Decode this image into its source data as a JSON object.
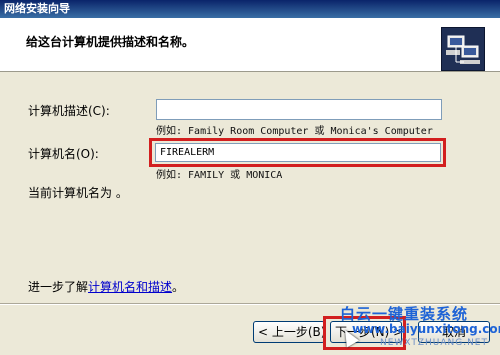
{
  "window": {
    "title": "网络安装向导"
  },
  "header": {
    "title": "给这台计算机提供描述和名称。",
    "icon": "network-computers-icon"
  },
  "form": {
    "description_label": "计算机描述(C):",
    "description_value": "",
    "description_example": "例如: Family Room Computer 或 Monica's Computer",
    "name_label": "计算机名(O):",
    "name_value": "FIREALERM",
    "name_example": "例如: FAMILY 或 MONICA",
    "current_name_text": "当前计算机名为 。"
  },
  "footer": {
    "learn_more_prefix": "进一步了解",
    "learn_more_link": "计算机名和描述",
    "learn_more_suffix": "。"
  },
  "buttons": {
    "back": "< 上一步(B)",
    "next": "下一步(N) >",
    "cancel": "取消"
  },
  "watermark": {
    "title": "白云一键重装系统",
    "url": "www.baiyunxitong.com",
    "url2": "NEWXTZHUANG.NET"
  },
  "highlight_color": "#d21f1f"
}
